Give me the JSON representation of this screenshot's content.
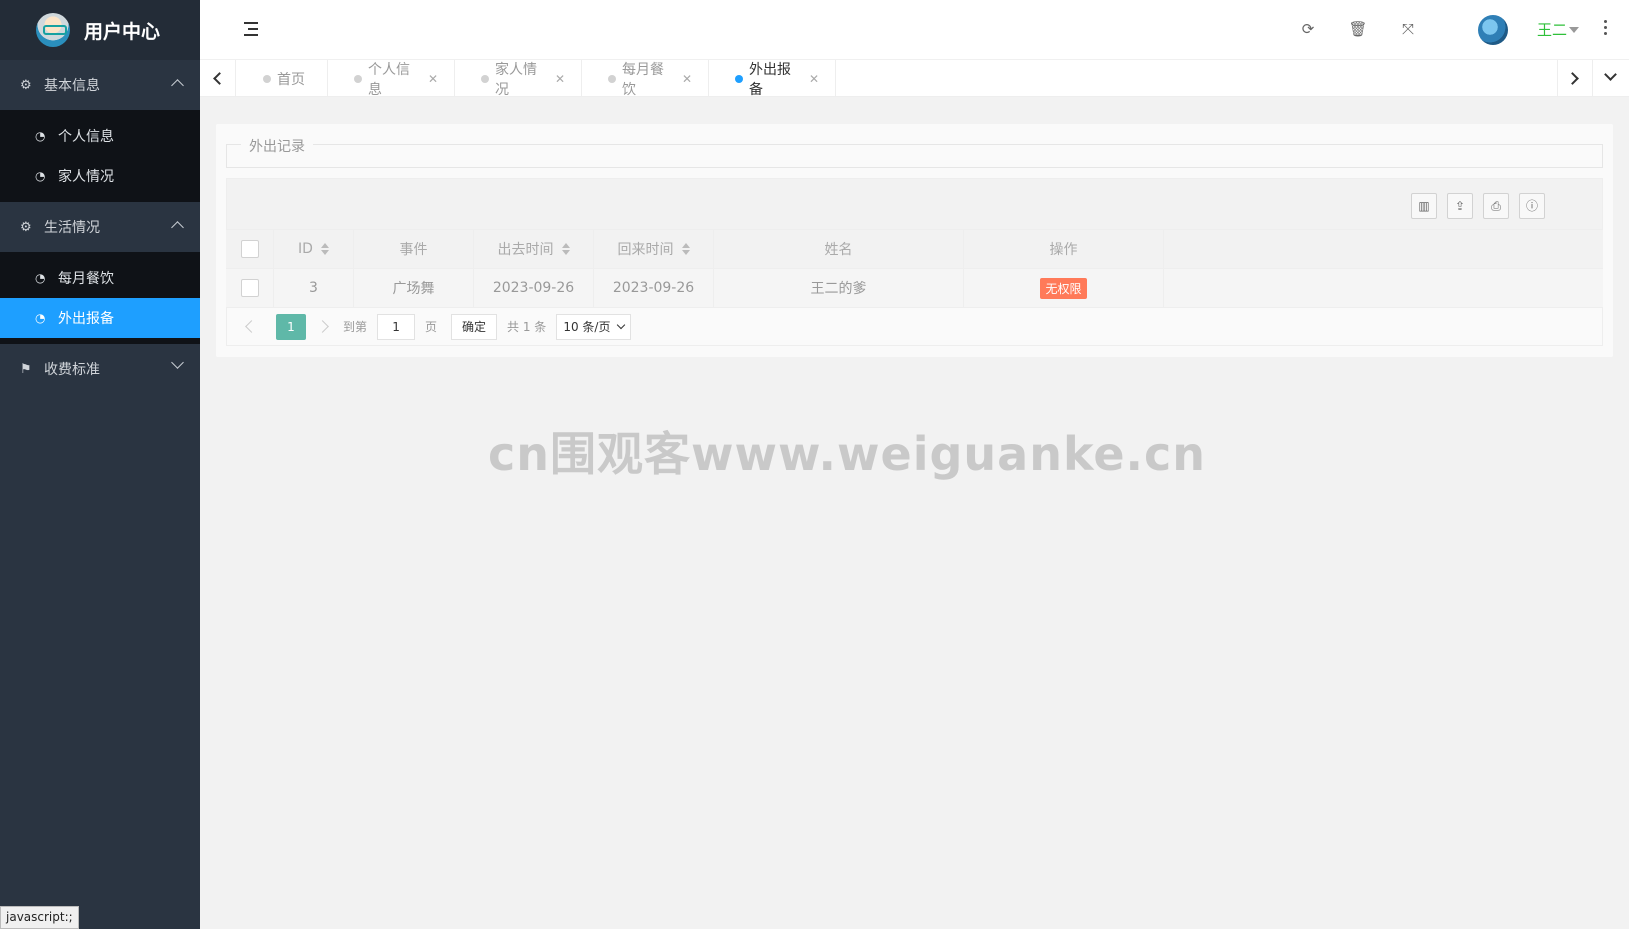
{
  "app": {
    "title": "用户中心"
  },
  "sidebar": {
    "groups": [
      {
        "label": "基本信息",
        "expanded": true,
        "items": [
          {
            "label": "个人信息"
          },
          {
            "label": "家人情况"
          }
        ]
      },
      {
        "label": "生活情况",
        "expanded": true,
        "items": [
          {
            "label": "每月餐饮"
          },
          {
            "label": "外出报备",
            "active": true
          }
        ]
      },
      {
        "label": "收费标准",
        "expanded": false,
        "items": []
      }
    ]
  },
  "header": {
    "user_name": "王二",
    "icons": [
      "refresh-icon",
      "trash-icon",
      "fullscreen-icon"
    ],
    "user_color": "#2fc03a"
  },
  "tabs": [
    {
      "label": "首页",
      "closable": false,
      "active": false
    },
    {
      "label": "个人信息",
      "closable": true,
      "active": false
    },
    {
      "label": "家人情况",
      "closable": true,
      "active": false
    },
    {
      "label": "每月餐饮",
      "closable": true,
      "active": false
    },
    {
      "label": "外出报备",
      "closable": true,
      "active": true
    }
  ],
  "panel": {
    "legend": "外出记录",
    "table": {
      "columns": [
        "ID",
        "事件",
        "出去时间",
        "回来时间",
        "姓名",
        "操作"
      ],
      "rows": [
        {
          "id": "3",
          "event": "广场舞",
          "out_time": "2023-09-26",
          "back_time": "2023-09-26",
          "name": "王二的爹",
          "action": "无权限"
        }
      ]
    },
    "pager": {
      "current": "1",
      "goto_label": "到第",
      "goto_value": "1",
      "page_suffix": "页",
      "confirm": "确定",
      "total": "共 1 条",
      "page_size": "10 条/页"
    }
  },
  "watermark": "cn围观客www.weiguanke.cn",
  "status_tip": "javascript:;",
  "colors": {
    "accent": "#1e9fff",
    "sidebar_bg": "#2a3441",
    "badge": "#ff7a59",
    "pager_current": "#5fb8a8"
  }
}
